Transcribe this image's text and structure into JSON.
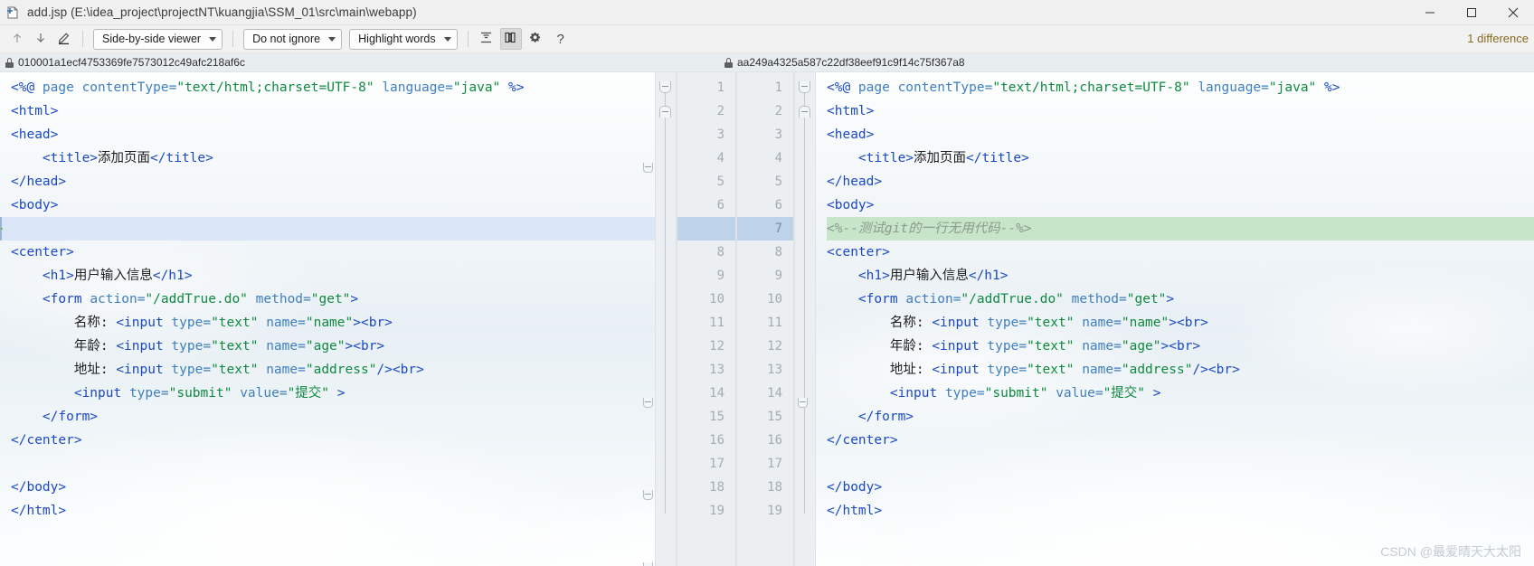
{
  "window": {
    "title": "add.jsp (E:\\idea_project\\projectNT\\kuangjia\\SSM_01\\src\\main\\webapp)",
    "icon": "file-diff-icon",
    "minimize_label": "Minimize",
    "maximize_label": "Maximize",
    "close_label": "Close"
  },
  "toolbar": {
    "prev_diff_icon": "arrow-up-icon",
    "next_diff_icon": "arrow-down-icon",
    "edit_icon": "pencil-icon",
    "viewer_mode": "Side-by-side viewer",
    "whitespace_mode": "Do not ignore",
    "highlight_mode": "Highlight words",
    "collapse_icon": "collapse-unchanged-icon",
    "columns_icon": "synchronize-scroll-icon",
    "settings_icon": "gear-icon",
    "help_icon": "?",
    "difference_count": "1 difference"
  },
  "revisions": {
    "left_lock_icon": "lock-icon",
    "left_hash": "010001a1ecf4753369fe7573012c49afc218af6c",
    "right_lock_icon": "lock-icon",
    "right_hash": "aa249a4325a587c22df38eef91c9f14c75f367a8"
  },
  "left_pane": {
    "line_numbers": [
      "1",
      "2",
      "3",
      "4",
      "5",
      "6",
      "",
      "8",
      "9",
      "10",
      "11",
      "12",
      "13",
      "14",
      "15",
      "16",
      "17",
      "18",
      "19"
    ],
    "lines": [
      {
        "n": "1",
        "tokens": [
          {
            "t": "<%@ ",
            "c": "t-tag"
          },
          {
            "t": "page ",
            "c": "t-attr"
          },
          {
            "t": "contentType=",
            "c": "t-attr"
          },
          {
            "t": "\"text/html;charset=UTF-8\"",
            "c": "t-str"
          },
          {
            "t": " ",
            "c": "t-text"
          },
          {
            "t": "language=",
            "c": "t-attr"
          },
          {
            "t": "\"java\"",
            "c": "t-str"
          },
          {
            "t": " %>",
            "c": "t-tag"
          }
        ]
      },
      {
        "n": "2",
        "tokens": [
          {
            "t": "<html>",
            "c": "t-tag"
          }
        ]
      },
      {
        "n": "3",
        "tokens": [
          {
            "t": "<head>",
            "c": "t-tag"
          }
        ]
      },
      {
        "n": "4",
        "tokens": [
          {
            "t": "    <title>",
            "c": "t-tag"
          },
          {
            "t": "添加页面",
            "c": "t-text"
          },
          {
            "t": "</title>",
            "c": "t-tag"
          }
        ]
      },
      {
        "n": "5",
        "tokens": [
          {
            "t": "</head>",
            "c": "t-tag"
          }
        ]
      },
      {
        "n": "6",
        "tokens": [
          {
            "t": "<body>",
            "c": "t-tag"
          }
        ]
      },
      {
        "n": "",
        "tokens": [
          {
            "t": "",
            "c": "t-text"
          }
        ]
      },
      {
        "n": "8",
        "tokens": [
          {
            "t": "<center>",
            "c": "t-tag"
          }
        ]
      },
      {
        "n": "9",
        "tokens": [
          {
            "t": "    <h1>",
            "c": "t-tag"
          },
          {
            "t": "用户输入信息",
            "c": "t-text"
          },
          {
            "t": "</h1>",
            "c": "t-tag"
          }
        ]
      },
      {
        "n": "10",
        "tokens": [
          {
            "t": "    <form ",
            "c": "t-tag"
          },
          {
            "t": "action=",
            "c": "t-attr"
          },
          {
            "t": "\"/addTrue.do\"",
            "c": "t-str"
          },
          {
            "t": " ",
            "c": "t-text"
          },
          {
            "t": "method=",
            "c": "t-attr"
          },
          {
            "t": "\"get\"",
            "c": "t-str"
          },
          {
            "t": ">",
            "c": "t-tag"
          }
        ]
      },
      {
        "n": "11",
        "tokens": [
          {
            "t": "        名称: ",
            "c": "t-text"
          },
          {
            "t": "<input ",
            "c": "t-tag"
          },
          {
            "t": "type=",
            "c": "t-attr"
          },
          {
            "t": "\"text\"",
            "c": "t-str"
          },
          {
            "t": " ",
            "c": "t-text"
          },
          {
            "t": "name=",
            "c": "t-attr"
          },
          {
            "t": "\"name\"",
            "c": "t-str"
          },
          {
            "t": "><br>",
            "c": "t-tag"
          }
        ]
      },
      {
        "n": "12",
        "tokens": [
          {
            "t": "        年龄: ",
            "c": "t-text"
          },
          {
            "t": "<input ",
            "c": "t-tag"
          },
          {
            "t": "type=",
            "c": "t-attr"
          },
          {
            "t": "\"text\"",
            "c": "t-str"
          },
          {
            "t": " ",
            "c": "t-text"
          },
          {
            "t": "name=",
            "c": "t-attr"
          },
          {
            "t": "\"age\"",
            "c": "t-str"
          },
          {
            "t": "><br>",
            "c": "t-tag"
          }
        ]
      },
      {
        "n": "13",
        "tokens": [
          {
            "t": "        地址: ",
            "c": "t-text"
          },
          {
            "t": "<input ",
            "c": "t-tag"
          },
          {
            "t": "type=",
            "c": "t-attr"
          },
          {
            "t": "\"text\"",
            "c": "t-str"
          },
          {
            "t": " ",
            "c": "t-text"
          },
          {
            "t": "name=",
            "c": "t-attr"
          },
          {
            "t": "\"address\"",
            "c": "t-str"
          },
          {
            "t": "/><br>",
            "c": "t-tag"
          }
        ]
      },
      {
        "n": "14",
        "tokens": [
          {
            "t": "        <input ",
            "c": "t-tag"
          },
          {
            "t": "type=",
            "c": "t-attr"
          },
          {
            "t": "\"submit\"",
            "c": "t-str"
          },
          {
            "t": " ",
            "c": "t-text"
          },
          {
            "t": "value=",
            "c": "t-attr"
          },
          {
            "t": "\"提交\"",
            "c": "t-str"
          },
          {
            "t": " >",
            "c": "t-tag"
          }
        ]
      },
      {
        "n": "15",
        "tokens": [
          {
            "t": "    </form>",
            "c": "t-tag"
          }
        ]
      },
      {
        "n": "16",
        "tokens": [
          {
            "t": "</center>",
            "c": "t-tag"
          }
        ]
      },
      {
        "n": "17",
        "tokens": [
          {
            "t": "",
            "c": "t-text"
          }
        ]
      },
      {
        "n": "18",
        "tokens": [
          {
            "t": "</body>",
            "c": "t-tag"
          }
        ]
      },
      {
        "n": "19",
        "tokens": [
          {
            "t": "</html>",
            "c": "t-tag"
          }
        ]
      }
    ]
  },
  "right_pane": {
    "lines": [
      {
        "n": "1",
        "changed": false,
        "tokens": [
          {
            "t": "<%@ ",
            "c": "t-tag"
          },
          {
            "t": "page ",
            "c": "t-attr"
          },
          {
            "t": "contentType=",
            "c": "t-attr"
          },
          {
            "t": "\"text/html;charset=UTF-8\"",
            "c": "t-str"
          },
          {
            "t": " ",
            "c": "t-text"
          },
          {
            "t": "language=",
            "c": "t-attr"
          },
          {
            "t": "\"java\"",
            "c": "t-str"
          },
          {
            "t": " %>",
            "c": "t-tag"
          }
        ]
      },
      {
        "n": "2",
        "changed": false,
        "tokens": [
          {
            "t": "<html>",
            "c": "t-tag"
          }
        ]
      },
      {
        "n": "3",
        "changed": false,
        "tokens": [
          {
            "t": "<head>",
            "c": "t-tag"
          }
        ]
      },
      {
        "n": "4",
        "changed": false,
        "tokens": [
          {
            "t": "    <title>",
            "c": "t-tag"
          },
          {
            "t": "添加页面",
            "c": "t-text"
          },
          {
            "t": "</title>",
            "c": "t-tag"
          }
        ]
      },
      {
        "n": "5",
        "changed": false,
        "tokens": [
          {
            "t": "</head>",
            "c": "t-tag"
          }
        ]
      },
      {
        "n": "6",
        "changed": false,
        "tokens": [
          {
            "t": "<body>",
            "c": "t-tag"
          }
        ]
      },
      {
        "n": "7",
        "changed": true,
        "tokens": [
          {
            "t": "<%--测试git的一行无用代码--%>",
            "c": "t-cmt"
          }
        ]
      },
      {
        "n": "8",
        "changed": false,
        "tokens": [
          {
            "t": "<center>",
            "c": "t-tag"
          }
        ]
      },
      {
        "n": "9",
        "changed": false,
        "tokens": [
          {
            "t": "    <h1>",
            "c": "t-tag"
          },
          {
            "t": "用户输入信息",
            "c": "t-text"
          },
          {
            "t": "</h1>",
            "c": "t-tag"
          }
        ]
      },
      {
        "n": "10",
        "changed": false,
        "tokens": [
          {
            "t": "    <form ",
            "c": "t-tag"
          },
          {
            "t": "action=",
            "c": "t-attr"
          },
          {
            "t": "\"/addTrue.do\"",
            "c": "t-str"
          },
          {
            "t": " ",
            "c": "t-text"
          },
          {
            "t": "method=",
            "c": "t-attr"
          },
          {
            "t": "\"get\"",
            "c": "t-str"
          },
          {
            "t": ">",
            "c": "t-tag"
          }
        ]
      },
      {
        "n": "11",
        "changed": false,
        "tokens": [
          {
            "t": "        名称: ",
            "c": "t-text"
          },
          {
            "t": "<input ",
            "c": "t-tag"
          },
          {
            "t": "type=",
            "c": "t-attr"
          },
          {
            "t": "\"text\"",
            "c": "t-str"
          },
          {
            "t": " ",
            "c": "t-text"
          },
          {
            "t": "name=",
            "c": "t-attr"
          },
          {
            "t": "\"name\"",
            "c": "t-str"
          },
          {
            "t": "><br>",
            "c": "t-tag"
          }
        ]
      },
      {
        "n": "12",
        "changed": false,
        "tokens": [
          {
            "t": "        年龄: ",
            "c": "t-text"
          },
          {
            "t": "<input ",
            "c": "t-tag"
          },
          {
            "t": "type=",
            "c": "t-attr"
          },
          {
            "t": "\"text\"",
            "c": "t-str"
          },
          {
            "t": " ",
            "c": "t-text"
          },
          {
            "t": "name=",
            "c": "t-attr"
          },
          {
            "t": "\"age\"",
            "c": "t-str"
          },
          {
            "t": "><br>",
            "c": "t-tag"
          }
        ]
      },
      {
        "n": "13",
        "changed": false,
        "tokens": [
          {
            "t": "        地址: ",
            "c": "t-text"
          },
          {
            "t": "<input ",
            "c": "t-tag"
          },
          {
            "t": "type=",
            "c": "t-attr"
          },
          {
            "t": "\"text\"",
            "c": "t-str"
          },
          {
            "t": " ",
            "c": "t-text"
          },
          {
            "t": "name=",
            "c": "t-attr"
          },
          {
            "t": "\"address\"",
            "c": "t-str"
          },
          {
            "t": "/><br>",
            "c": "t-tag"
          }
        ]
      },
      {
        "n": "14",
        "changed": false,
        "tokens": [
          {
            "t": "        <input ",
            "c": "t-tag"
          },
          {
            "t": "type=",
            "c": "t-attr"
          },
          {
            "t": "\"submit\"",
            "c": "t-str"
          },
          {
            "t": " ",
            "c": "t-text"
          },
          {
            "t": "value=",
            "c": "t-attr"
          },
          {
            "t": "\"提交\"",
            "c": "t-str"
          },
          {
            "t": " >",
            "c": "t-tag"
          }
        ]
      },
      {
        "n": "15",
        "changed": false,
        "tokens": [
          {
            "t": "    </form>",
            "c": "t-tag"
          }
        ]
      },
      {
        "n": "16",
        "changed": false,
        "tokens": [
          {
            "t": "</center>",
            "c": "t-tag"
          }
        ]
      },
      {
        "n": "17",
        "changed": false,
        "tokens": [
          {
            "t": "",
            "c": "t-text"
          }
        ]
      },
      {
        "n": "18",
        "changed": false,
        "tokens": [
          {
            "t": "</body>",
            "c": "t-tag"
          }
        ]
      },
      {
        "n": "19",
        "changed": false,
        "tokens": [
          {
            "t": "</html>",
            "c": "t-tag"
          }
        ]
      }
    ]
  },
  "watermark": "CSDN @最爱晴天大太阳",
  "colors": {
    "added_line_bg": "#c7e5c9",
    "caret_line_bg": "#dbe7f6",
    "gutter_bg": "#eceff1",
    "diff_count_text": "#8a6a1f",
    "tag": "#1a49c4",
    "string": "#0f8a3f",
    "attr": "#3f7fbf",
    "comment": "#8b9a8b"
  }
}
